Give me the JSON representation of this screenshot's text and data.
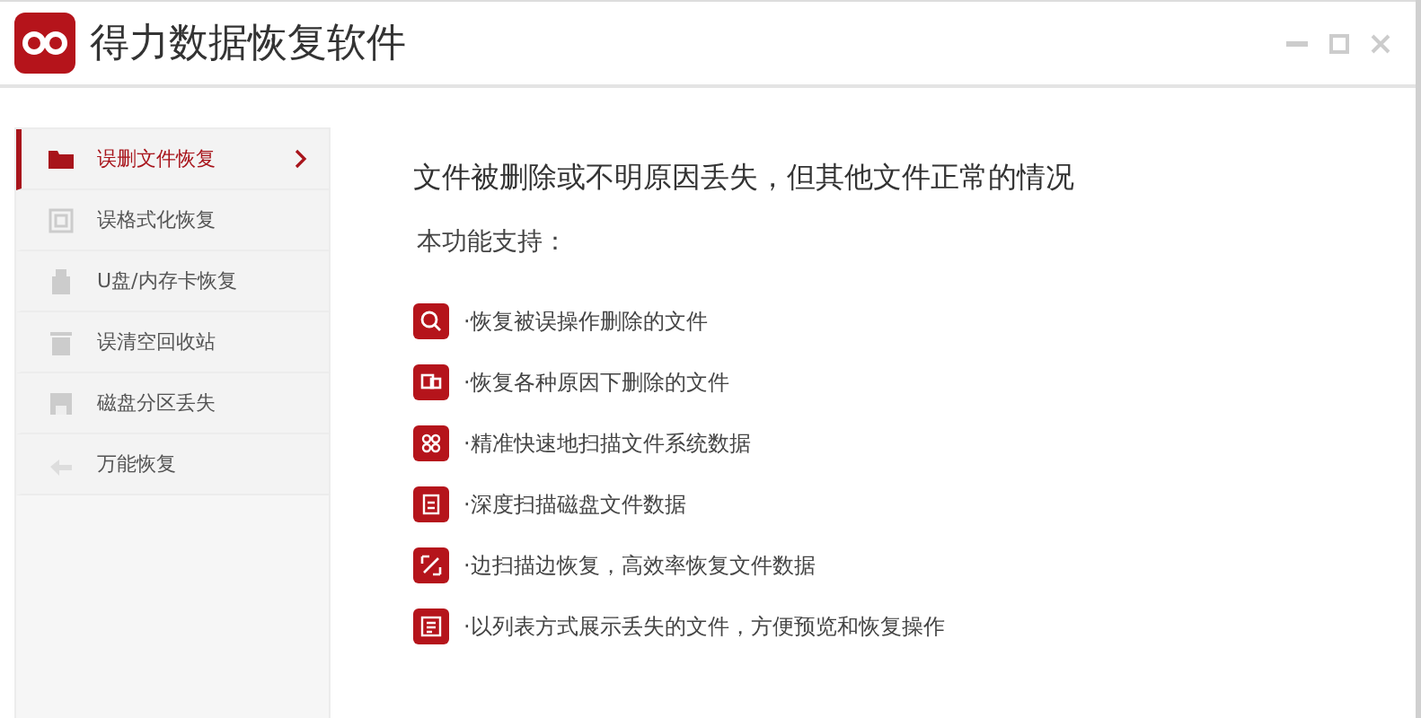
{
  "window": {
    "title": "得力数据恢复软件"
  },
  "sidebar": {
    "items": [
      {
        "label": "误删文件恢复",
        "selected": true
      },
      {
        "label": "误格式化恢复",
        "selected": false
      },
      {
        "label": "U盘/内存卡恢复",
        "selected": false
      },
      {
        "label": "误清空回收站",
        "selected": false
      },
      {
        "label": "磁盘分区丢失",
        "selected": false
      },
      {
        "label": "万能恢复",
        "selected": false
      }
    ]
  },
  "content": {
    "heading": "文件被删除或不明原因丢失，但其他文件正常的情况",
    "subheading": "本功能支持：",
    "features": [
      "·恢复被误操作删除的文件",
      "·恢复各种原因下删除的文件",
      "·精准快速地扫描文件系统数据",
      "·深度扫描磁盘文件数据",
      "·边扫描边恢复，高效率恢复文件数据",
      "·以列表方式展示丢失的文件，方便预览和恢复操作"
    ]
  }
}
